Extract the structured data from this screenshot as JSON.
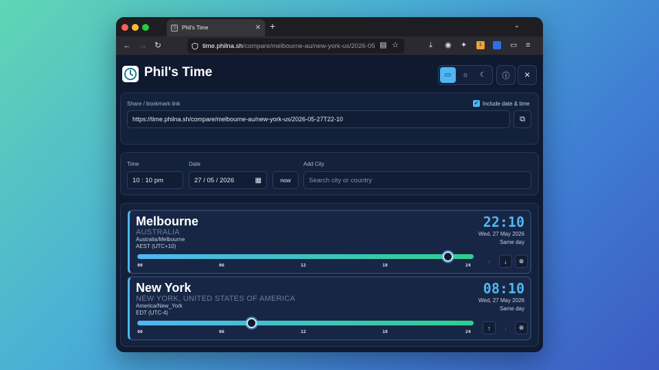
{
  "browser": {
    "tab_title": "Phil's Time",
    "tab_close": "✕",
    "new_tab": "+",
    "tab_menu": "⌄",
    "url_domain": "time.philna.sh",
    "url_path": "/compare/melbourne-au/new-york-us/2026-05",
    "extension_badge": "1",
    "traffic_lights": [
      "#ff5f57",
      "#febc2e",
      "#28c840"
    ]
  },
  "app": {
    "title": "Phil's Time",
    "accent": "#4fb7f3"
  },
  "share": {
    "label": "Share / bookmark link",
    "include_label": "Include date & time",
    "include_checked": true,
    "url": "https://time.philna.sh/compare/melbourne-au/new-york-us/2026-05-27T22-10"
  },
  "controls": {
    "time_label": "Time",
    "time_value": "10 : 10  pm",
    "date_label": "Date",
    "date_value": "27 / 05 / 2026",
    "now_label": "now",
    "add_city_label": "Add City",
    "search_placeholder": "Search city or country"
  },
  "ticks": [
    "00",
    "06",
    "12",
    "18",
    "24"
  ],
  "cities": [
    {
      "name": "Melbourne",
      "country": "AUSTRALIA",
      "zone": "Australia/Melbourne",
      "offset": "AEST (UTC+10)",
      "time": "22:10",
      "date": "Wed, 27 May 2026",
      "day": "Same day",
      "slider_hour": 22.17
    },
    {
      "name": "New York",
      "country": "NEW YORK, UNITED STATES OF AMERICA",
      "zone": "America/New_York",
      "offset": "EDT (UTC-4)",
      "time": "08:10",
      "date": "Wed, 27 May 2026",
      "day": "Same day",
      "slider_hour": 8.17
    }
  ]
}
